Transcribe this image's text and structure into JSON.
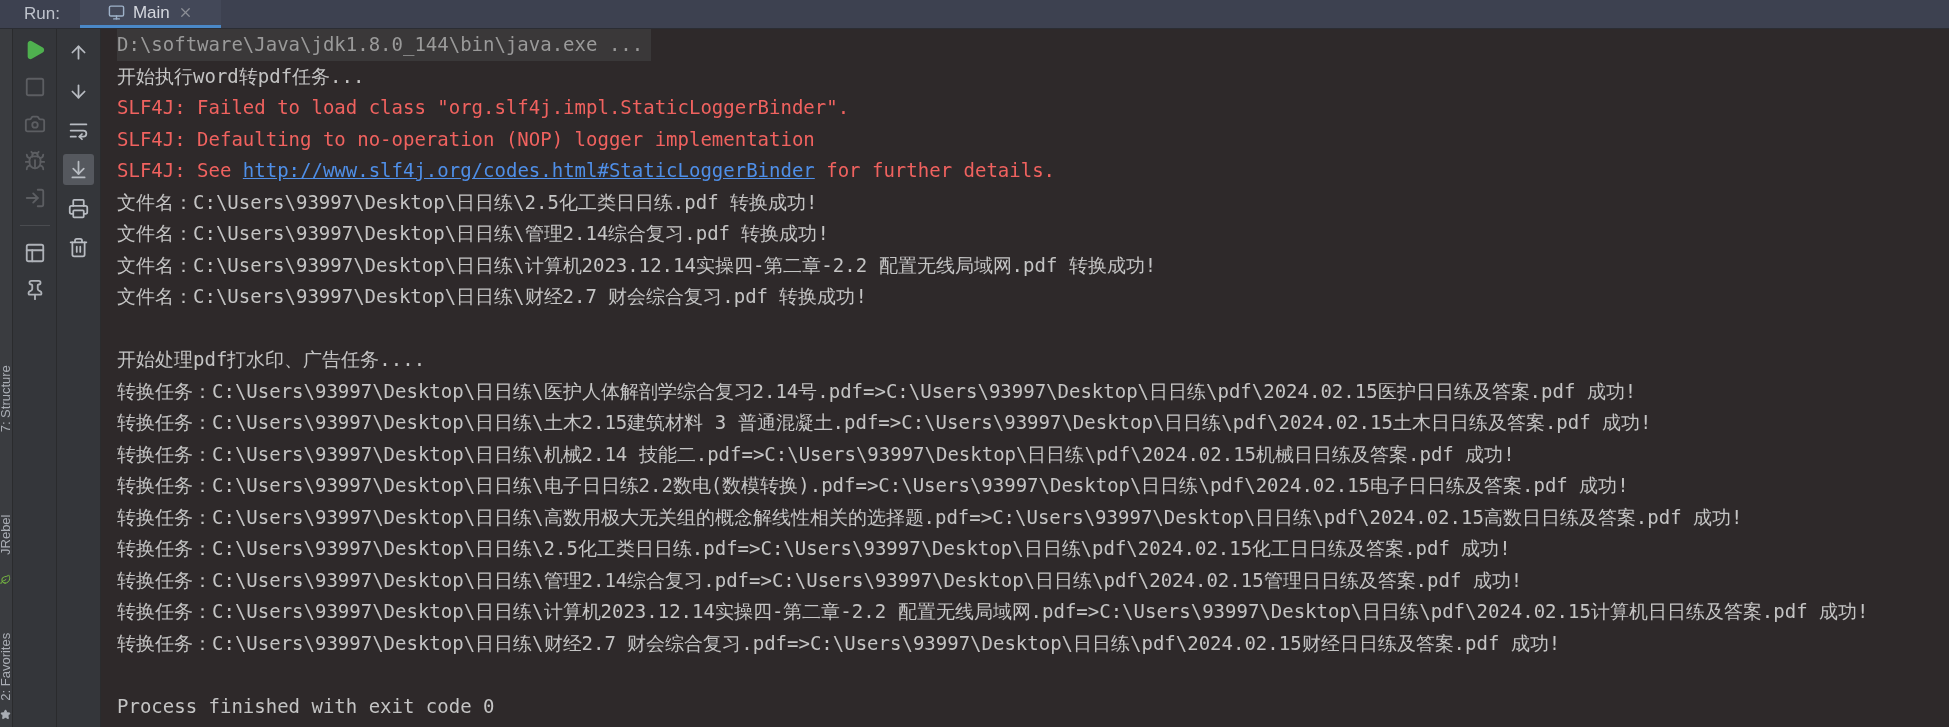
{
  "run_bar": {
    "label": "Run:",
    "tabs": [
      {
        "label": "Main",
        "selected": true,
        "closable": true
      }
    ]
  },
  "side_stripe": [
    {
      "kind": "label",
      "label": "7: Structure"
    },
    {
      "kind": "label",
      "label": "JRebel"
    },
    {
      "kind": "label",
      "label": "2: Favorites"
    }
  ],
  "toolbar_primary": [
    {
      "kind": "run",
      "disabled": false
    },
    {
      "kind": "stop",
      "disabled": true
    },
    {
      "kind": "camera",
      "disabled": true
    },
    {
      "kind": "bug",
      "disabled": true
    },
    {
      "kind": "exit",
      "disabled": true
    },
    {
      "kind": "layout",
      "disabled": false
    },
    {
      "kind": "pin",
      "disabled": false
    }
  ],
  "toolbar_secondary": [
    {
      "kind": "up",
      "selected": false
    },
    {
      "kind": "down",
      "selected": false
    },
    {
      "kind": "wrap",
      "selected": false
    },
    {
      "kind": "scroll_end",
      "selected": true
    },
    {
      "kind": "print",
      "selected": false
    },
    {
      "kind": "trash",
      "selected": false
    }
  ],
  "console": [
    {
      "kind": "command",
      "text": "D:\\software\\Java\\jdk1.8.0_144\\bin\\java.exe ..."
    },
    {
      "kind": "info",
      "text": "开始执行word转pdf任务..."
    },
    {
      "kind": "error",
      "text": "SLF4J: Failed to load class \"org.slf4j.impl.StaticLoggerBinder\"."
    },
    {
      "kind": "error",
      "text": "SLF4J: Defaulting to no-operation (NOP) logger implementation"
    },
    {
      "kind": "error",
      "text": "SLF4J: See ",
      "link": "http://www.slf4j.org/codes.html#StaticLoggerBinder",
      "after": " for further details."
    },
    {
      "kind": "info",
      "text": "文件名：C:\\Users\\93997\\Desktop\\日日练\\2.5化工类日日练.pdf 转换成功!"
    },
    {
      "kind": "info",
      "text": "文件名：C:\\Users\\93997\\Desktop\\日日练\\管理2.14综合复习.pdf 转换成功!"
    },
    {
      "kind": "info",
      "text": "文件名：C:\\Users\\93997\\Desktop\\日日练\\计算机2023.12.14实操四-第二章-2.2 配置无线局域网.pdf 转换成功!"
    },
    {
      "kind": "info",
      "text": "文件名：C:\\Users\\93997\\Desktop\\日日练\\财经2.7 财会综合复习.pdf 转换成功!"
    },
    {
      "kind": "blank"
    },
    {
      "kind": "info",
      "text": "开始处理pdf打水印、广告任务...."
    },
    {
      "kind": "info",
      "text": "转换任务：C:\\Users\\93997\\Desktop\\日日练\\医护人体解剖学综合复习2.14号.pdf=>C:\\Users\\93997\\Desktop\\日日练\\pdf\\2024.02.15医护日日练及答案.pdf 成功!"
    },
    {
      "kind": "info",
      "text": "转换任务：C:\\Users\\93997\\Desktop\\日日练\\土木2.15建筑材料 3 普通混凝土.pdf=>C:\\Users\\93997\\Desktop\\日日练\\pdf\\2024.02.15土木日日练及答案.pdf 成功!"
    },
    {
      "kind": "info",
      "text": "转换任务：C:\\Users\\93997\\Desktop\\日日练\\机械2.14 技能二.pdf=>C:\\Users\\93997\\Desktop\\日日练\\pdf\\2024.02.15机械日日练及答案.pdf 成功!"
    },
    {
      "kind": "info",
      "text": "转换任务：C:\\Users\\93997\\Desktop\\日日练\\电子日日练2.2数电(数模转换).pdf=>C:\\Users\\93997\\Desktop\\日日练\\pdf\\2024.02.15电子日日练及答案.pdf 成功!"
    },
    {
      "kind": "info",
      "text": "转换任务：C:\\Users\\93997\\Desktop\\日日练\\高数用极大无关组的概念解线性相关的选择题.pdf=>C:\\Users\\93997\\Desktop\\日日练\\pdf\\2024.02.15高数日日练及答案.pdf 成功!"
    },
    {
      "kind": "info",
      "text": "转换任务：C:\\Users\\93997\\Desktop\\日日练\\2.5化工类日日练.pdf=>C:\\Users\\93997\\Desktop\\日日练\\pdf\\2024.02.15化工日日练及答案.pdf 成功!"
    },
    {
      "kind": "info",
      "text": "转换任务：C:\\Users\\93997\\Desktop\\日日练\\管理2.14综合复习.pdf=>C:\\Users\\93997\\Desktop\\日日练\\pdf\\2024.02.15管理日日练及答案.pdf 成功!"
    },
    {
      "kind": "info",
      "text": "转换任务：C:\\Users\\93997\\Desktop\\日日练\\计算机2023.12.14实操四-第二章-2.2 配置无线局域网.pdf=>C:\\Users\\93997\\Desktop\\日日练\\pdf\\2024.02.15计算机日日练及答案.pdf 成功!"
    },
    {
      "kind": "info",
      "text": "转换任务：C:\\Users\\93997\\Desktop\\日日练\\财经2.7 财会综合复习.pdf=>C:\\Users\\93997\\Desktop\\日日练\\pdf\\2024.02.15财经日日练及答案.pdf 成功!"
    },
    {
      "kind": "blank"
    },
    {
      "kind": "info",
      "text": "Process finished with exit code 0"
    }
  ]
}
